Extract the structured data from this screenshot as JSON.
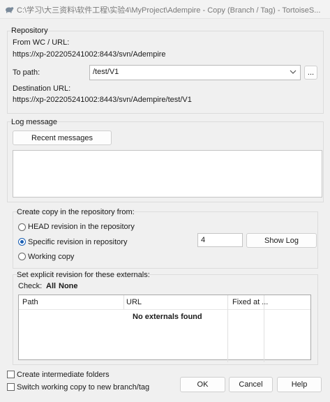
{
  "window": {
    "title": "C:\\学习\\大三资料\\软件工程\\实验4\\MyProject\\Adempire - Copy (Branch / Tag) - TortoiseS..."
  },
  "repository": {
    "legend": "Repository",
    "from_label": "From WC / URL:",
    "from_url": "https://xp-202205241002:8443/svn/Adempire",
    "to_path_label": "To path:",
    "to_path_value": "/test/V1",
    "browse_label": "...",
    "dest_label": "Destination URL:",
    "dest_url": "https://xp-202205241002:8443/svn/Adempire/test/V1"
  },
  "log": {
    "legend": "Log message",
    "recent_label": "Recent messages",
    "message": ""
  },
  "copy_from": {
    "legend": "Create copy in the repository from:",
    "options": [
      "HEAD revision in the repository",
      "Specific revision in repository",
      "Working copy"
    ],
    "selected_index": 1,
    "revision_value": "4",
    "show_log_label": "Show Log"
  },
  "externals": {
    "legend": "Set explicit revision for these externals:",
    "check_label": "Check:",
    "all_label": "All",
    "none_label": "None",
    "columns": [
      "Path",
      "URL",
      "Fixed at ..."
    ],
    "empty_text": "No externals found"
  },
  "options": {
    "intermediate_label": "Create intermediate folders",
    "intermediate_checked": false,
    "switch_label": "Switch working copy to new branch/tag",
    "switch_checked": false
  },
  "buttons": {
    "ok": "OK",
    "cancel": "Cancel",
    "help": "Help"
  }
}
